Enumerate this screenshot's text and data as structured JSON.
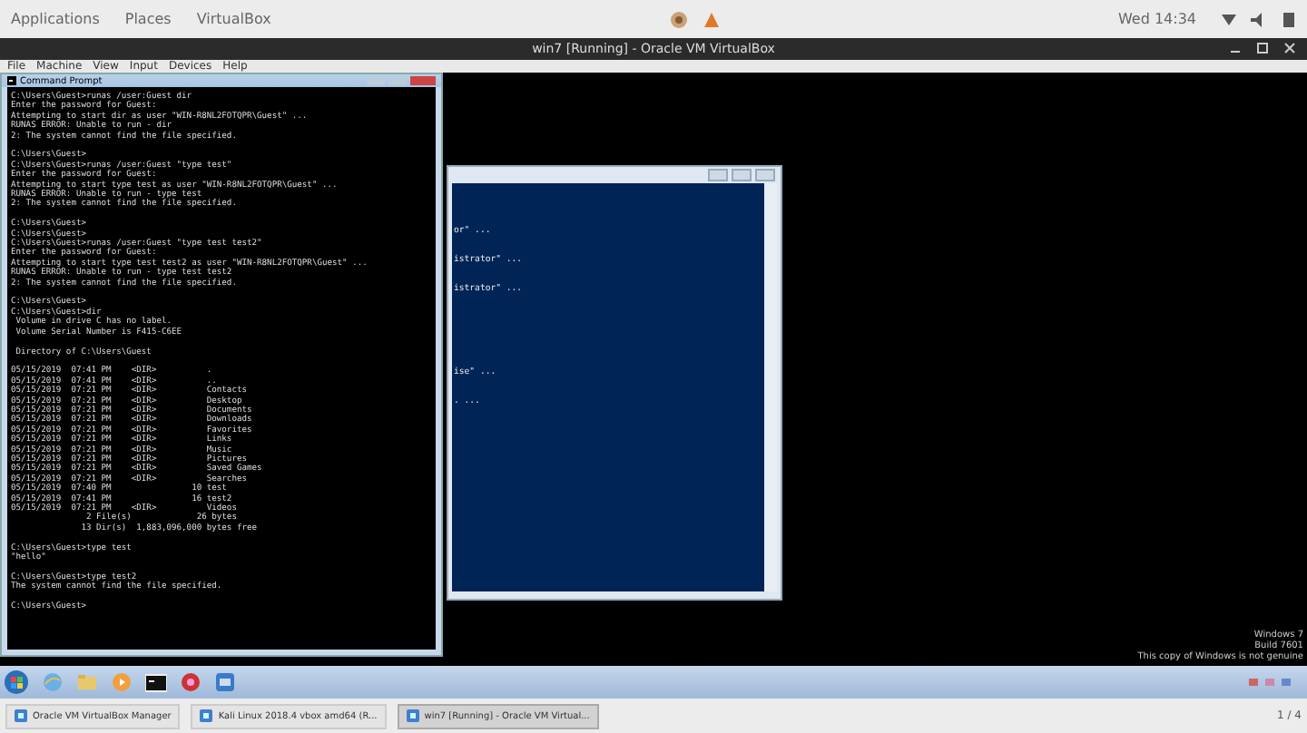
{
  "top_bar": {
    "menus": [
      "Applications",
      "Places",
      "VirtualBox"
    ],
    "clock": "Wed 14:34"
  },
  "vbox_window": {
    "title": "win7 [Running] - Oracle VM VirtualBox",
    "menu": [
      "File",
      "Machine",
      "View",
      "Input",
      "Devices",
      "Help"
    ]
  },
  "cmd_window": {
    "title": "Command Prompt",
    "blocks": [
      [
        "C:\\Users\\Guest>runas /user:Guest dir",
        "Enter the password for Guest:",
        "Attempting to start dir as user \"WIN-R8NL2FOTQPR\\Guest\" ...",
        "RUNAS ERROR: Unable to run - dir",
        "2: The system cannot find the file specified."
      ],
      [
        "C:\\Users\\Guest>",
        "C:\\Users\\Guest>runas /user:Guest \"type test\"",
        "Enter the password for Guest:",
        "Attempting to start type test as user \"WIN-R8NL2FOTQPR\\Guest\" ...",
        "RUNAS ERROR: Unable to run - type test",
        "2: The system cannot find the file specified."
      ],
      [
        "C:\\Users\\Guest>",
        "C:\\Users\\Guest>",
        "C:\\Users\\Guest>runas /user:Guest \"type test test2\"",
        "Enter the password for Guest:",
        "Attempting to start type test test2 as user \"WIN-R8NL2FOTQPR\\Guest\" ...",
        "RUNAS ERROR: Unable to run - type test test2",
        "2: The system cannot find the file specified."
      ],
      [
        "C:\\Users\\Guest>",
        "C:\\Users\\Guest>dir",
        " Volume in drive C has no label.",
        " Volume Serial Number is F415-C6EE"
      ],
      [
        " Directory of C:\\Users\\Guest"
      ],
      [
        "05/15/2019  07:41 PM    <DIR>          .",
        "05/15/2019  07:41 PM    <DIR>          ..",
        "05/15/2019  07:21 PM    <DIR>          Contacts",
        "05/15/2019  07:21 PM    <DIR>          Desktop",
        "05/15/2019  07:21 PM    <DIR>          Documents",
        "05/15/2019  07:21 PM    <DIR>          Downloads",
        "05/15/2019  07:21 PM    <DIR>          Favorites",
        "05/15/2019  07:21 PM    <DIR>          Links",
        "05/15/2019  07:21 PM    <DIR>          Music",
        "05/15/2019  07:21 PM    <DIR>          Pictures",
        "05/15/2019  07:21 PM    <DIR>          Saved Games",
        "05/15/2019  07:21 PM    <DIR>          Searches",
        "05/15/2019  07:40 PM                10 test",
        "05/15/2019  07:41 PM                16 test2",
        "05/15/2019  07:21 PM    <DIR>          Videos",
        "               2 File(s)             26 bytes",
        "              13 Dir(s)  1,883,096,000 bytes free"
      ],
      [
        "C:\\Users\\Guest>type test",
        "\"hello\""
      ],
      [
        "C:\\Users\\Guest>type test2",
        "The system cannot find the file specified."
      ],
      [
        "C:\\Users\\Guest>"
      ]
    ]
  },
  "powershell_window": {
    "blocks": [
      [
        "or\" ..."
      ],
      [
        "istrator\" ..."
      ],
      [
        "istrator\" ..."
      ],
      [
        "ise\" ..."
      ],
      [
        ". ..."
      ]
    ]
  },
  "watermark": [
    "Windows 7",
    "Build 7601",
    "This copy of Windows is not genuine"
  ],
  "host_taskbar": {
    "items": [
      {
        "label": "Oracle VM VirtualBox Manager",
        "selected": false
      },
      {
        "label": "Kali Linux 2018.4 vbox amd64 (R...",
        "selected": false
      },
      {
        "label": "win7 [Running] - Oracle VM Virtual...",
        "selected": true
      }
    ],
    "workspace": "1 / 4"
  }
}
